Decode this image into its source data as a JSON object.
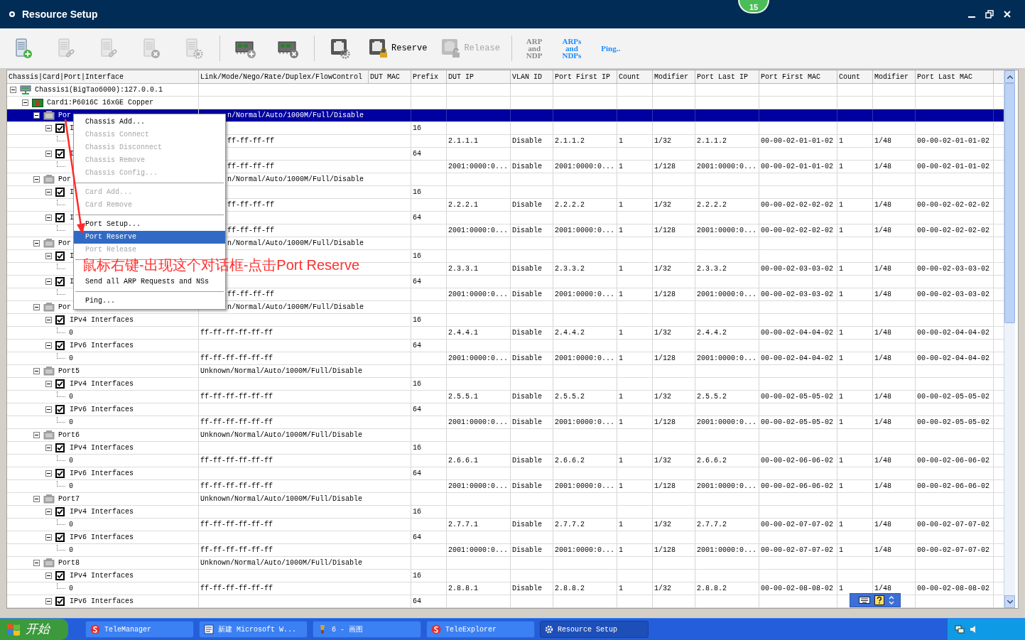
{
  "window": {
    "title": "Resource Setup",
    "notification_badge": "15"
  },
  "toolbar": [
    {
      "kind": "icon",
      "disabled": false
    },
    {
      "kind": "icon",
      "disabled": true
    },
    {
      "kind": "icon",
      "disabled": true
    },
    {
      "kind": "icon",
      "disabled": true
    },
    {
      "kind": "icon",
      "disabled": true
    },
    {
      "kind": "separator"
    },
    {
      "kind": "icon",
      "disabled": false
    },
    {
      "kind": "icon",
      "disabled": false
    },
    {
      "kind": "separator"
    },
    {
      "kind": "icon",
      "disabled": false
    },
    {
      "kind": "icon_text",
      "label": "Reserve",
      "disabled": false
    },
    {
      "kind": "icon_text",
      "label": "Release",
      "disabled": true
    },
    {
      "kind": "separator"
    },
    {
      "kind": "text",
      "lines": [
        "ARP",
        "and",
        "NDP"
      ],
      "disabled": true
    },
    {
      "kind": "text",
      "lines": [
        "ARPs",
        "and",
        "NDPs"
      ],
      "disabled": false
    },
    {
      "kind": "text",
      "lines": [
        "Ping.."
      ],
      "disabled": false
    }
  ],
  "table": {
    "columns": [
      "Chassis|Card|Port|Interface",
      "Link/Mode/Nego/Rate/Duplex/FlowControl",
      "DUT MAC",
      "Prefix",
      "DUT IP",
      "VLAN ID",
      "Port First IP",
      "Count",
      "Modifier",
      "Port Last IP",
      "Port First MAC",
      "Count",
      "Modifier",
      "Port Last MAC"
    ],
    "rows": [
      {
        "kind": "chassis",
        "label": "Chassis1(BigTao6000):127.0.0.1",
        "expanded": true,
        "selected": false,
        "children": [
          {
            "kind": "card",
            "label": "Card1:P6016C 16xGE Copper",
            "expanded": true,
            "selected": false,
            "children": [
              {
                "kind": "port",
                "label": "Por",
                "covered": true,
                "expanded": true,
                "selected": true,
                "cells": {
                  "link": "n/Normal/Auto/1000M/Full/Disable"
                },
                "children": [
                  {
                    "kind": "iface",
                    "label": "I",
                    "expanded": true,
                    "checked": true,
                    "selected": false,
                    "cells": {
                      "prefix": "16"
                    },
                    "children": [
                      {
                        "kind": "addr",
                        "covered": true,
                        "selected": false,
                        "cells": {
                          "link": "ff-ff-ff-ff",
                          "dut_ip": "2.1.1.1",
                          "vlan_id": "Disable",
                          "port_first_ip": "2.1.1.2",
                          "ip_count": "1",
                          "ip_modifier": "1/32",
                          "port_last_ip": "2.1.1.2",
                          "port_first_mac": "00-00-02-01-01-02",
                          "mac_count": "1",
                          "mac_modifier": "1/48",
                          "port_last_mac": "00-00-02-01-01-02"
                        }
                      }
                    ]
                  },
                  {
                    "kind": "iface",
                    "label": "I",
                    "expanded": true,
                    "checked": true,
                    "selected": false,
                    "cells": {
                      "prefix": "64"
                    },
                    "children": [
                      {
                        "kind": "addr",
                        "covered": true,
                        "selected": false,
                        "cells": {
                          "link": "ff-ff-ff-ff",
                          "dut_ip": "2001:0000:0...",
                          "vlan_id": "Disable",
                          "port_first_ip": "2001:0000:0...",
                          "ip_count": "1",
                          "ip_modifier": "1/128",
                          "port_last_ip": "2001:0000:0...",
                          "port_first_mac": "00-00-02-01-01-02",
                          "mac_count": "1",
                          "mac_modifier": "1/48",
                          "port_last_mac": "00-00-02-01-01-02"
                        }
                      }
                    ]
                  }
                ]
              },
              {
                "kind": "port",
                "label": "Por",
                "covered": true,
                "expanded": true,
                "selected": false,
                "cells": {
                  "link": "n/Normal/Auto/1000M/Full/Disable"
                },
                "children": [
                  {
                    "kind": "iface",
                    "label": "I",
                    "expanded": true,
                    "checked": true,
                    "selected": false,
                    "cells": {
                      "prefix": "16"
                    },
                    "children": [
                      {
                        "kind": "addr",
                        "covered": true,
                        "selected": false,
                        "cells": {
                          "link": "ff-ff-ff-ff",
                          "dut_ip": "2.2.2.1",
                          "vlan_id": "Disable",
                          "port_first_ip": "2.2.2.2",
                          "ip_count": "1",
                          "ip_modifier": "1/32",
                          "port_last_ip": "2.2.2.2",
                          "port_first_mac": "00-00-02-02-02-02",
                          "mac_count": "1",
                          "mac_modifier": "1/48",
                          "port_last_mac": "00-00-02-02-02-02"
                        }
                      }
                    ]
                  },
                  {
                    "kind": "iface",
                    "label": "I",
                    "expanded": true,
                    "checked": true,
                    "selected": false,
                    "cells": {
                      "prefix": "64"
                    },
                    "children": [
                      {
                        "kind": "addr",
                        "covered": true,
                        "selected": false,
                        "cells": {
                          "link": "ff-ff-ff-ff",
                          "dut_ip": "2001:0000:0...",
                          "vlan_id": "Disable",
                          "port_first_ip": "2001:0000:0...",
                          "ip_count": "1",
                          "ip_modifier": "1/128",
                          "port_last_ip": "2001:0000:0...",
                          "port_first_mac": "00-00-02-02-02-02",
                          "mac_count": "1",
                          "mac_modifier": "1/48",
                          "port_last_mac": "00-00-02-02-02-02"
                        }
                      }
                    ]
                  }
                ]
              },
              {
                "kind": "port",
                "label": "Por",
                "covered": true,
                "expanded": true,
                "selected": false,
                "cells": {
                  "link": "n/Normal/Auto/1000M/Full/Disable"
                },
                "children": [
                  {
                    "kind": "iface",
                    "label": "I",
                    "expanded": true,
                    "checked": true,
                    "selected": false,
                    "cells": {
                      "prefix": "16"
                    },
                    "children": [
                      {
                        "kind": "addr",
                        "selected": false,
                        "cells": {
                          "dut_ip": "2.3.3.1",
                          "vlan_id": "Disable",
                          "port_first_ip": "2.3.3.2",
                          "ip_count": "1",
                          "ip_modifier": "1/32",
                          "port_last_ip": "2.3.3.2",
                          "port_first_mac": "00-00-02-03-03-02",
                          "mac_count": "1",
                          "mac_modifier": "1/48",
                          "port_last_mac": "00-00-02-03-03-02"
                        }
                      }
                    ]
                  },
                  {
                    "kind": "iface",
                    "label": "I",
                    "expanded": true,
                    "checked": true,
                    "selected": false,
                    "cells": {
                      "prefix": "64"
                    },
                    "children": [
                      {
                        "kind": "addr",
                        "covered": true,
                        "selected": false,
                        "cells": {
                          "link": "ff-ff-ff-ff",
                          "dut_ip": "2001:0000:0...",
                          "vlan_id": "Disable",
                          "port_first_ip": "2001:0000:0...",
                          "ip_count": "1",
                          "ip_modifier": "1/128",
                          "port_last_ip": "2001:0000:0...",
                          "port_first_mac": "00-00-02-03-03-02",
                          "mac_count": "1",
                          "mac_modifier": "1/48",
                          "port_last_mac": "00-00-02-03-03-02"
                        }
                      }
                    ]
                  }
                ]
              },
              {
                "kind": "port",
                "label": "Por",
                "covered": true,
                "expanded": true,
                "selected": false,
                "cells": {
                  "link": "n/Normal/Auto/1000M/Full/Disable"
                },
                "children": [
                  {
                    "kind": "iface",
                    "label": "IPv4 Interfaces",
                    "expanded": true,
                    "checked": true,
                    "selected": false,
                    "cells": {
                      "prefix": "16"
                    },
                    "children": [
                      {
                        "kind": "addr",
                        "label": "0",
                        "selected": false,
                        "cells": {
                          "link": "ff-ff-ff-ff-ff-ff",
                          "dut_ip": "2.4.4.1",
                          "vlan_id": "Disable",
                          "port_first_ip": "2.4.4.2",
                          "ip_count": "1",
                          "ip_modifier": "1/32",
                          "port_last_ip": "2.4.4.2",
                          "port_first_mac": "00-00-02-04-04-02",
                          "mac_count": "1",
                          "mac_modifier": "1/48",
                          "port_last_mac": "00-00-02-04-04-02"
                        }
                      }
                    ]
                  },
                  {
                    "kind": "iface",
                    "label": "IPv6 Interfaces",
                    "expanded": true,
                    "checked": true,
                    "selected": false,
                    "cells": {
                      "prefix": "64"
                    },
                    "children": [
                      {
                        "kind": "addr",
                        "label": "0",
                        "selected": false,
                        "cells": {
                          "link": "ff-ff-ff-ff-ff-ff",
                          "dut_ip": "2001:0000:0...",
                          "vlan_id": "Disable",
                          "port_first_ip": "2001:0000:0...",
                          "ip_count": "1",
                          "ip_modifier": "1/128",
                          "port_last_ip": "2001:0000:0...",
                          "port_first_mac": "00-00-02-04-04-02",
                          "mac_count": "1",
                          "mac_modifier": "1/48",
                          "port_last_mac": "00-00-02-04-04-02"
                        }
                      }
                    ]
                  }
                ]
              },
              {
                "kind": "port",
                "label": "Port5",
                "expanded": true,
                "selected": false,
                "cells": {
                  "link": "Unknown/Normal/Auto/1000M/Full/Disable"
                },
                "children": [
                  {
                    "kind": "iface",
                    "label": "IPv4 Interfaces",
                    "expanded": true,
                    "checked": true,
                    "selected": false,
                    "cells": {
                      "prefix": "16"
                    },
                    "children": [
                      {
                        "kind": "addr",
                        "label": "0",
                        "selected": false,
                        "cells": {
                          "link": "ff-ff-ff-ff-ff-ff",
                          "dut_ip": "2.5.5.1",
                          "vlan_id": "Disable",
                          "port_first_ip": "2.5.5.2",
                          "ip_count": "1",
                          "ip_modifier": "1/32",
                          "port_last_ip": "2.5.5.2",
                          "port_first_mac": "00-00-02-05-05-02",
                          "mac_count": "1",
                          "mac_modifier": "1/48",
                          "port_last_mac": "00-00-02-05-05-02"
                        }
                      }
                    ]
                  },
                  {
                    "kind": "iface",
                    "label": "IPv6 Interfaces",
                    "expanded": true,
                    "checked": true,
                    "selected": false,
                    "cells": {
                      "prefix": "64"
                    },
                    "children": [
                      {
                        "kind": "addr",
                        "label": "0",
                        "selected": false,
                        "cells": {
                          "link": "ff-ff-ff-ff-ff-ff",
                          "dut_ip": "2001:0000:0...",
                          "vlan_id": "Disable",
                          "port_first_ip": "2001:0000:0...",
                          "ip_count": "1",
                          "ip_modifier": "1/128",
                          "port_last_ip": "2001:0000:0...",
                          "port_first_mac": "00-00-02-05-05-02",
                          "mac_count": "1",
                          "mac_modifier": "1/48",
                          "port_last_mac": "00-00-02-05-05-02"
                        }
                      }
                    ]
                  }
                ]
              },
              {
                "kind": "port",
                "label": "Port6",
                "expanded": true,
                "selected": false,
                "cells": {
                  "link": "Unknown/Normal/Auto/1000M/Full/Disable"
                },
                "children": [
                  {
                    "kind": "iface",
                    "label": "IPv4 Interfaces",
                    "expanded": true,
                    "checked": true,
                    "selected": false,
                    "cells": {
                      "prefix": "16"
                    },
                    "children": [
                      {
                        "kind": "addr",
                        "label": "0",
                        "selected": false,
                        "cells": {
                          "link": "ff-ff-ff-ff-ff-ff",
                          "dut_ip": "2.6.6.1",
                          "vlan_id": "Disable",
                          "port_first_ip": "2.6.6.2",
                          "ip_count": "1",
                          "ip_modifier": "1/32",
                          "port_last_ip": "2.6.6.2",
                          "port_first_mac": "00-00-02-06-06-02",
                          "mac_count": "1",
                          "mac_modifier": "1/48",
                          "port_last_mac": "00-00-02-06-06-02"
                        }
                      }
                    ]
                  },
                  {
                    "kind": "iface",
                    "label": "IPv6 Interfaces",
                    "expanded": true,
                    "checked": true,
                    "selected": false,
                    "cells": {
                      "prefix": "64"
                    },
                    "children": [
                      {
                        "kind": "addr",
                        "label": "0",
                        "selected": false,
                        "cells": {
                          "link": "ff-ff-ff-ff-ff-ff",
                          "dut_ip": "2001:0000:0...",
                          "vlan_id": "Disable",
                          "port_first_ip": "2001:0000:0...",
                          "ip_count": "1",
                          "ip_modifier": "1/128",
                          "port_last_ip": "2001:0000:0...",
                          "port_first_mac": "00-00-02-06-06-02",
                          "mac_count": "1",
                          "mac_modifier": "1/48",
                          "port_last_mac": "00-00-02-06-06-02"
                        }
                      }
                    ]
                  }
                ]
              },
              {
                "kind": "port",
                "label": "Port7",
                "expanded": true,
                "selected": false,
                "cells": {
                  "link": "Unknown/Normal/Auto/1000M/Full/Disable"
                },
                "children": [
                  {
                    "kind": "iface",
                    "label": "IPv4 Interfaces",
                    "expanded": true,
                    "checked": true,
                    "selected": false,
                    "cells": {
                      "prefix": "16"
                    },
                    "children": [
                      {
                        "kind": "addr",
                        "label": "0",
                        "selected": false,
                        "cells": {
                          "link": "ff-ff-ff-ff-ff-ff",
                          "dut_ip": "2.7.7.1",
                          "vlan_id": "Disable",
                          "port_first_ip": "2.7.7.2",
                          "ip_count": "1",
                          "ip_modifier": "1/32",
                          "port_last_ip": "2.7.7.2",
                          "port_first_mac": "00-00-02-07-07-02",
                          "mac_count": "1",
                          "mac_modifier": "1/48",
                          "port_last_mac": "00-00-02-07-07-02"
                        }
                      }
                    ]
                  },
                  {
                    "kind": "iface",
                    "label": "IPv6 Interfaces",
                    "expanded": true,
                    "checked": true,
                    "selected": false,
                    "cells": {
                      "prefix": "64"
                    },
                    "children": [
                      {
                        "kind": "addr",
                        "label": "0",
                        "selected": false,
                        "cells": {
                          "link": "ff-ff-ff-ff-ff-ff",
                          "dut_ip": "2001:0000:0...",
                          "vlan_id": "Disable",
                          "port_first_ip": "2001:0000:0...",
                          "ip_count": "1",
                          "ip_modifier": "1/128",
                          "port_last_ip": "2001:0000:0...",
                          "port_first_mac": "00-00-02-07-07-02",
                          "mac_count": "1",
                          "mac_modifier": "1/48",
                          "port_last_mac": "00-00-02-07-07-02"
                        }
                      }
                    ]
                  }
                ]
              },
              {
                "kind": "port",
                "label": "Port8",
                "expanded": true,
                "selected": false,
                "cells": {
                  "link": "Unknown/Normal/Auto/1000M/Full/Disable"
                },
                "children": [
                  {
                    "kind": "iface",
                    "label": "IPv4 Interfaces",
                    "expanded": true,
                    "checked": true,
                    "selected": false,
                    "cells": {
                      "prefix": "16"
                    },
                    "children": [
                      {
                        "kind": "addr",
                        "label": "0",
                        "selected": false,
                        "cells": {
                          "link": "ff-ff-ff-ff-ff-ff",
                          "dut_ip": "2.8.8.1",
                          "vlan_id": "Disable",
                          "port_first_ip": "2.8.8.2",
                          "ip_count": "1",
                          "ip_modifier": "1/32",
                          "port_last_ip": "2.8.8.2",
                          "port_first_mac": "00-00-02-08-08-02",
                          "mac_count": "1",
                          "mac_modifier": "1/48",
                          "port_last_mac": "00-00-02-08-08-02"
                        }
                      }
                    ]
                  },
                  {
                    "kind": "iface",
                    "label": "IPv6 Interfaces",
                    "expanded": true,
                    "checked": true,
                    "selected": false,
                    "cells": {
                      "prefix": "64"
                    }
                  }
                ]
              }
            ]
          }
        ]
      }
    ]
  },
  "context_menu": {
    "items": [
      {
        "kind": "item",
        "label": "Chassis Add...",
        "disabled": false,
        "selected": false
      },
      {
        "kind": "item",
        "label": "Chassis Connect",
        "disabled": true,
        "selected": false
      },
      {
        "kind": "item",
        "label": "Chassis Disconnect",
        "disabled": true,
        "selected": false
      },
      {
        "kind": "item",
        "label": "Chassis Remove",
        "disabled": true,
        "selected": false
      },
      {
        "kind": "item",
        "label": "Chassis Config...",
        "disabled": true,
        "selected": false
      },
      {
        "kind": "separator"
      },
      {
        "kind": "item",
        "label": "Card Add...",
        "disabled": true,
        "selected": false
      },
      {
        "kind": "item",
        "label": "Card Remove",
        "disabled": true,
        "selected": false
      },
      {
        "kind": "separator"
      },
      {
        "kind": "item",
        "label": "Port Setup...",
        "disabled": false,
        "selected": false
      },
      {
        "kind": "item",
        "label": "Port Reserve",
        "disabled": false,
        "selected": true
      },
      {
        "kind": "item",
        "label": "Port Release",
        "disabled": true,
        "selected": false
      },
      {
        "kind": "separator"
      },
      {
        "kind": "blank"
      },
      {
        "kind": "item",
        "label": "Send all ARP Requests and NSs",
        "disabled": false,
        "selected": false
      },
      {
        "kind": "separator"
      },
      {
        "kind": "item",
        "label": "Ping...",
        "disabled": false,
        "selected": false
      }
    ]
  },
  "annotation": {
    "text": "鼠标右键-出现这个对话框-点击Port Reserve"
  },
  "taskbar": {
    "start": "开始",
    "items": [
      {
        "label": "TeleManager",
        "selected": false
      },
      {
        "label": "新建 Microsoft W...",
        "selected": false
      },
      {
        "label": "6 - 画图",
        "selected": false
      },
      {
        "label": "TeleExplorer",
        "selected": false
      },
      {
        "label": "Resource Setup",
        "selected": true
      }
    ]
  }
}
